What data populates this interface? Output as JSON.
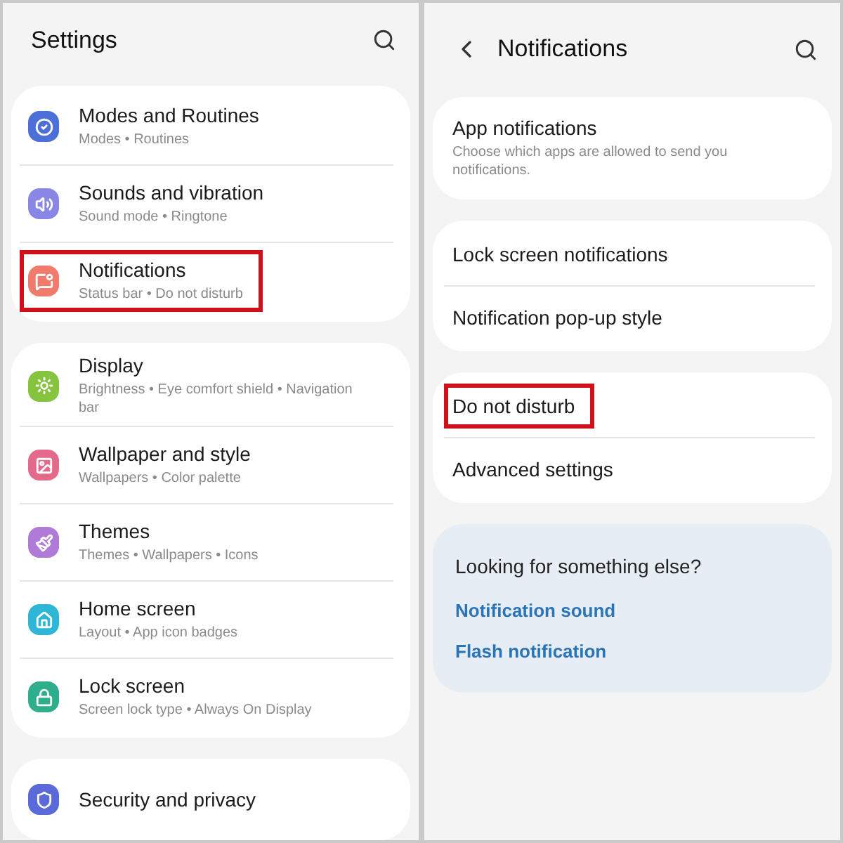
{
  "settings_screen": {
    "title": "Settings",
    "groups": [
      {
        "items": [
          {
            "kind": "routines",
            "title": "Modes and Routines",
            "subtitle": "Modes • Routines",
            "highlighted": false
          },
          {
            "kind": "sound",
            "title": "Sounds and vibration",
            "subtitle": "Sound mode • Ringtone",
            "highlighted": false
          },
          {
            "kind": "notifications",
            "title": "Notifications",
            "subtitle": "Status bar • Do not disturb",
            "highlighted": true
          }
        ]
      },
      {
        "items": [
          {
            "kind": "display",
            "title": "Display",
            "subtitle": "Brightness • Eye comfort shield • Navigation bar",
            "highlighted": false
          },
          {
            "kind": "wallpaper",
            "title": "Wallpaper and style",
            "subtitle": "Wallpapers • Color palette",
            "highlighted": false
          },
          {
            "kind": "themes",
            "title": "Themes",
            "subtitle": "Themes • Wallpapers • Icons",
            "highlighted": false
          },
          {
            "kind": "home",
            "title": "Home screen",
            "subtitle": "Layout • App icon badges",
            "highlighted": false
          },
          {
            "kind": "lock",
            "title": "Lock screen",
            "subtitle": "Screen lock type • Always On Display",
            "highlighted": false
          }
        ]
      },
      {
        "items": [
          {
            "kind": "security",
            "title": "Security and privacy",
            "highlighted": false
          }
        ]
      }
    ]
  },
  "notifications_screen": {
    "title": "Notifications",
    "groups": [
      {
        "items": [
          {
            "title": "App notifications",
            "subtitle": "Choose which apps are allowed to send you notifications.",
            "highlighted": false
          }
        ]
      },
      {
        "items": [
          {
            "title": "Lock screen notifications",
            "highlighted": false
          },
          {
            "title": "Notification pop-up style",
            "highlighted": false
          }
        ]
      },
      {
        "items": [
          {
            "title": "Do not disturb",
            "highlighted": true
          },
          {
            "title": "Advanced settings",
            "highlighted": false
          }
        ]
      }
    ],
    "suggestions": {
      "title": "Looking for something else?",
      "links": [
        "Notification sound",
        "Flash notification"
      ]
    }
  }
}
